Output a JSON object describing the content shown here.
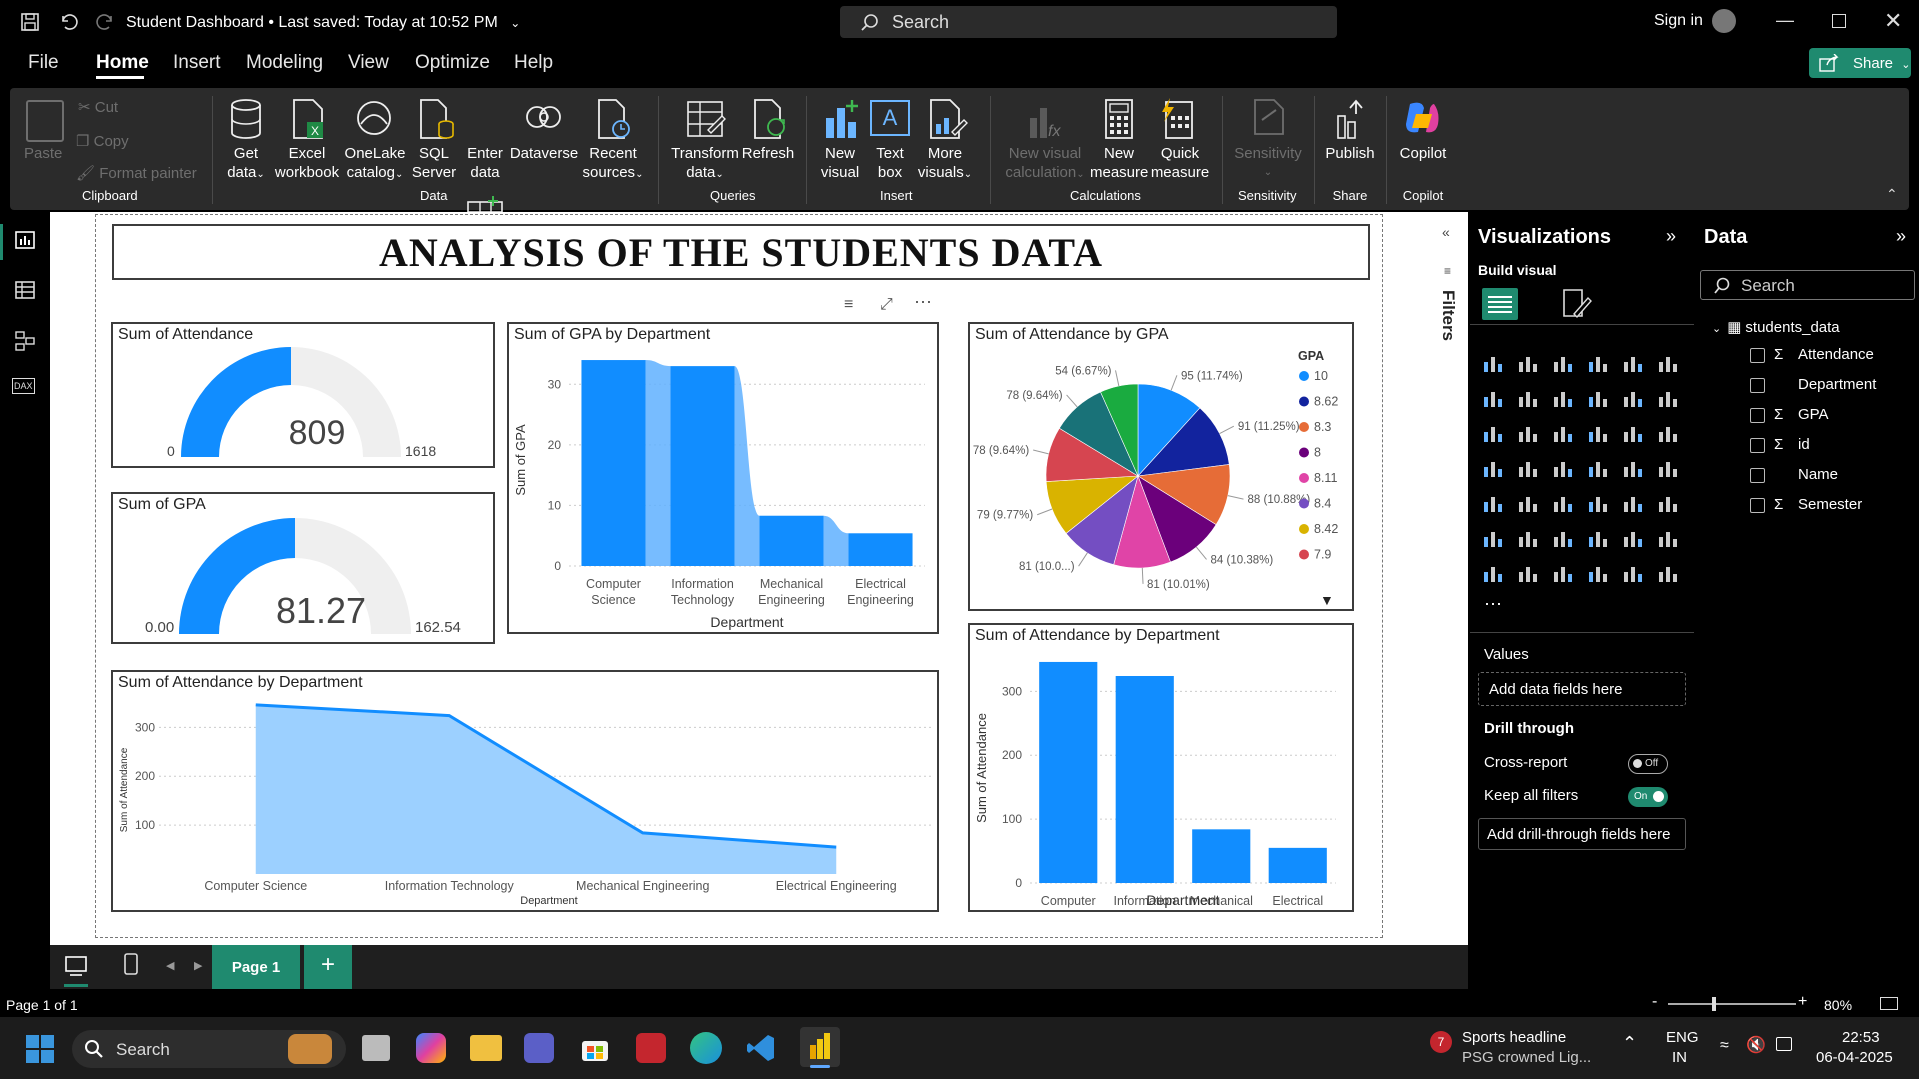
{
  "app": {
    "title": "Student Dashboard",
    "saved": "Last saved: Today at 10:52 PM",
    "search_placeholder": "Search",
    "sign_in": "Sign in",
    "share": "Share"
  },
  "menu": [
    "File",
    "Home",
    "Insert",
    "Modeling",
    "View",
    "Optimize",
    "Help"
  ],
  "ribbon": {
    "clipboard": {
      "paste": "Paste",
      "cut": "Cut",
      "copy": "Copy",
      "format_painter": "Format painter",
      "group": "Clipboard"
    },
    "data": {
      "get_data": [
        "Get",
        "data"
      ],
      "excel": [
        "Excel",
        "workbook"
      ],
      "onelake": [
        "OneLake",
        "catalog"
      ],
      "sql": [
        "SQL",
        "Server"
      ],
      "enter": [
        "Enter",
        "data"
      ],
      "dataverse": "Dataverse",
      "recent": [
        "Recent",
        "sources"
      ],
      "group": "Data"
    },
    "queries": {
      "transform": [
        "Transform",
        "data"
      ],
      "refresh": "Refresh",
      "group": "Queries"
    },
    "insert": {
      "new_visual": [
        "New",
        "visual"
      ],
      "text_box": [
        "Text",
        "box"
      ],
      "more_visuals": [
        "More",
        "visuals"
      ],
      "group": "Insert"
    },
    "calculations": {
      "new_visual_calc": [
        "New visual",
        "calculation"
      ],
      "new_measure": [
        "New",
        "measure"
      ],
      "quick_measure": [
        "Quick",
        "measure"
      ],
      "group": "Calculations"
    },
    "sensitivity": {
      "label": "Sensitivity",
      "group": "Sensitivity"
    },
    "share": {
      "publish": "Publish",
      "group": "Share"
    },
    "copilot": {
      "label": "Copilot",
      "group": "Copilot"
    }
  },
  "report": {
    "main_title": "ANALYSIS OF THE STUDENTS DATA",
    "gauge_attendance": {
      "title": "Sum of Attendance",
      "value": "809",
      "min": "0",
      "max": "1618",
      "fraction": 0.5
    },
    "gauge_gpa": {
      "title": "Sum of GPA",
      "value": "81.27",
      "min": "0.00",
      "max": "162.54",
      "fraction": 0.5
    }
  },
  "chart_data": [
    {
      "id": "gpa_by_dept",
      "type": "bar",
      "title": "Sum of GPA by Department",
      "xlabel": "Department",
      "ylabel": "Sum of GPA",
      "categories": [
        "Computer Science",
        "Information Technology",
        "Mechanical Engineering",
        "Electrical Engineering"
      ],
      "values": [
        34,
        33,
        8.3,
        5.4
      ],
      "yticks": [
        0,
        10,
        20,
        30
      ],
      "ylim": [
        0,
        35
      ],
      "grid": true
    },
    {
      "id": "attendance_by_gpa",
      "type": "pie",
      "title": "Sum of Attendance by GPA",
      "legend_title": "GPA",
      "legend_position": "right",
      "slices": [
        {
          "label": "10",
          "value": 95,
          "display": "95 (11.74%)",
          "color": "#118DFF"
        },
        {
          "label": "8.62",
          "value": 91,
          "display": "91 (11.25%)",
          "color": "#12239E"
        },
        {
          "label": "8.3",
          "value": 88,
          "display": "88 (10.88%)",
          "color": "#E66C37"
        },
        {
          "label": "8",
          "value": 84,
          "display": "84 (10.38%)",
          "color": "#6B007B"
        },
        {
          "label": "8.11",
          "value": 81,
          "display": "81 (10.01%)",
          "color": "#E044A7"
        },
        {
          "label": "8.4",
          "value": 81,
          "display": "81 (10.0...)",
          "color": "#744EC2"
        },
        {
          "label": "8.42",
          "value": 79,
          "display": "79 (9.77%)",
          "color": "#D9B300"
        },
        {
          "label": "7.9",
          "value": 78,
          "display": "78 (9.64%)",
          "color": "#D64550"
        },
        {
          "label": "",
          "value": 78,
          "display": "78 (9.64%)",
          "color": "#197278"
        },
        {
          "label": "",
          "value": 54,
          "display": "54 (6.67%)",
          "color": "#1AAB40"
        }
      ]
    },
    {
      "id": "attendance_by_dept_area",
      "type": "area",
      "title": "Sum of Attendance by Department",
      "xlabel": "Department",
      "ylabel": "Sum of Attendance",
      "categories": [
        "Computer Science",
        "Information Technology",
        "Mechanical Engineering",
        "Electrical Engineering"
      ],
      "values": [
        346,
        324,
        84,
        55
      ],
      "yticks": [
        100,
        200,
        300
      ],
      "ylim": [
        0,
        360
      ],
      "grid": true
    },
    {
      "id": "attendance_by_dept_bar",
      "type": "bar",
      "title": "Sum of Attendance by Department",
      "xlabel": "Department",
      "ylabel": "Sum of Attendance",
      "categories": [
        "Computer Science",
        "Information Technology",
        "Mechanical Engineeri...",
        "Electrical Engineeri..."
      ],
      "values": [
        346,
        324,
        84,
        55
      ],
      "yticks": [
        0,
        100,
        200,
        300
      ],
      "ylim": [
        0,
        360
      ],
      "grid": true
    }
  ],
  "filters_label": "Filters",
  "visualizations": {
    "title": "Visualizations",
    "build": "Build visual",
    "values": "Values",
    "add_fields": "Add data fields here",
    "drill": "Drill through",
    "cross_report": "Cross-report",
    "cross_state": "Off",
    "keep_filters": "Keep all filters",
    "keep_state": "On",
    "add_drill": "Add drill-through fields here"
  },
  "data_pane": {
    "title": "Data",
    "search": "Search",
    "table": "students_data",
    "fields": [
      {
        "name": "Attendance",
        "sigma": true
      },
      {
        "name": "Department",
        "sigma": false
      },
      {
        "name": "GPA",
        "sigma": true
      },
      {
        "name": "id",
        "sigma": true
      },
      {
        "name": "Name",
        "sigma": false
      },
      {
        "name": "Semester",
        "sigma": true
      }
    ]
  },
  "pages": {
    "current": "Page 1",
    "status": "Page 1 of 1",
    "zoom": "80%"
  },
  "taskbar": {
    "search": "Search",
    "news_title": "Sports headline",
    "news_sub": "PSG crowned Lig...",
    "lang1": "ENG",
    "lang2": "IN",
    "time": "22:53",
    "date": "06-04-2025",
    "badge": "7"
  }
}
